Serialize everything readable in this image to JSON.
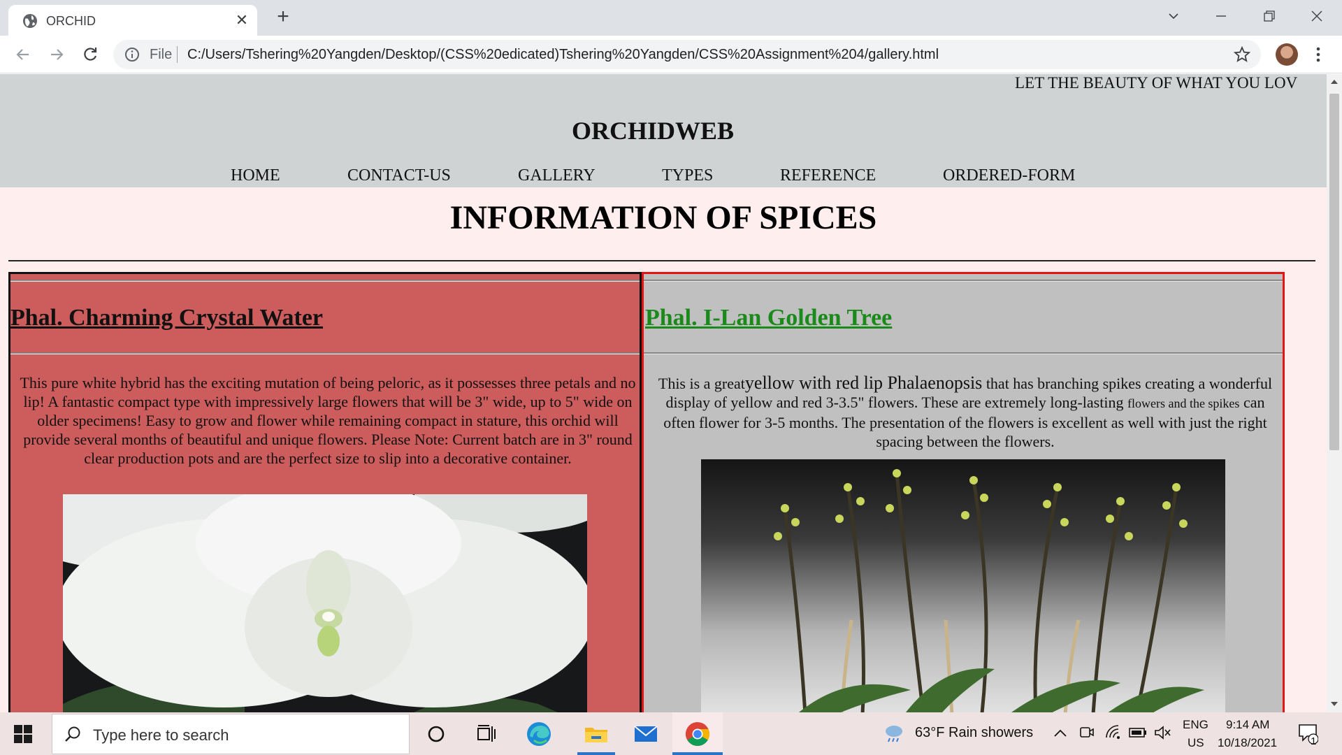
{
  "browser": {
    "tab_title": "ORCHID",
    "url_scheme": "File",
    "url": "C:/Users/Tshering%20Yangden/Desktop/(CSS%20edicated)Tshering%20Yangden/CSS%20Assignment%204/gallery.html"
  },
  "site": {
    "marquee": "LET THE BEAUTY OF WHAT YOU LOV",
    "title": "ORCHIDWEB",
    "nav": [
      "HOME",
      "CONTACT-US",
      "GALLERY",
      "TYPES",
      "REFERENCE",
      "ORDERED-FORM"
    ],
    "page_heading": "INFORMATION OF SPICES"
  },
  "panels": {
    "left": {
      "title": "Phal. Charming Crystal Water",
      "description": "This pure white hybrid has the exciting mutation of being peloric, as it possesses three petals and no lip! A fantastic compact type with impressively large flowers that will be 3\" wide, up to 5\" wide on older specimens! Easy to grow and flower while remaining compact in stature, this orchid will provide several months of beautiful and unique flowers. Please Note: Current batch are in 3\" round clear production pots and are the perfect size to slip into a decorative container.",
      "bg_color": "#cd5c5c"
    },
    "right": {
      "title": "Phal. I-Lan Golden Tree",
      "desc_part1": "This is a great",
      "desc_part2": "yellow with red lip Phalaenopsis",
      "desc_part3": " that has branching spikes creating a wonderful display of yellow and red 3-3.5\" flowers. These are extremely long-lasting ",
      "desc_part4": "flowers and the spikes",
      "desc_part5": " can often flower for 3-5 months. The presentation of the flowers is excellent as well with just the right spacing between the flowers.",
      "title_color": "#1a8a1a",
      "border_color": "#e31414"
    }
  },
  "taskbar": {
    "search_placeholder": "Type here to search",
    "weather": "63°F  Rain showers",
    "lang_top": "ENG",
    "lang_bottom": "US",
    "time": "9:14 AM",
    "date": "10/18/2021",
    "notification_count": "1"
  }
}
